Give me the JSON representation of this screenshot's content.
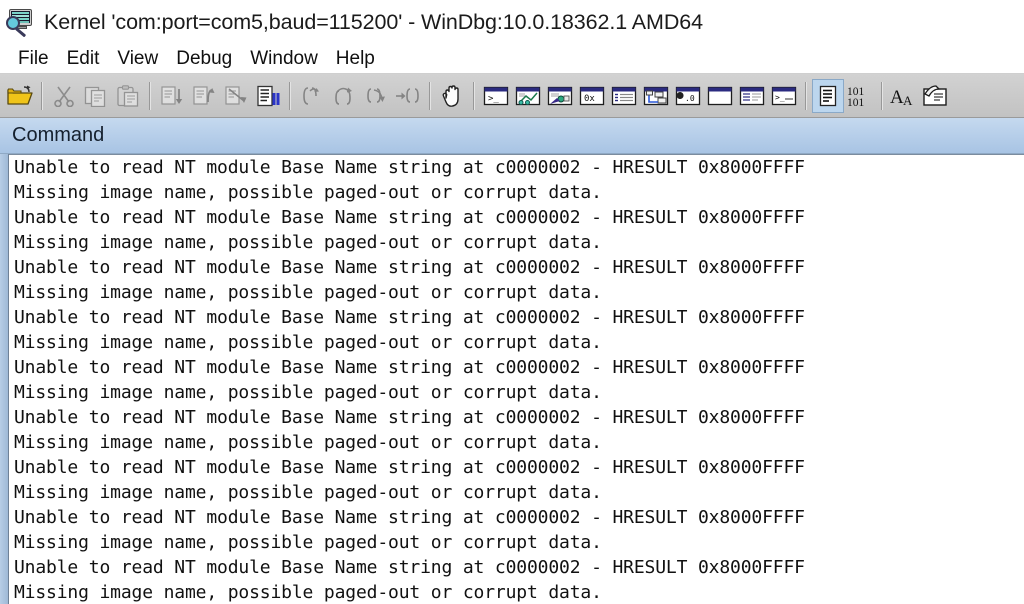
{
  "window": {
    "icon": "windbg-monitor-magnifier-icon",
    "title": "Kernel 'com:port=com5,baud=115200' - WinDbg:10.0.18362.1 AMD64"
  },
  "menubar": {
    "items": [
      {
        "label": "File",
        "name": "menu-file"
      },
      {
        "label": "Edit",
        "name": "menu-edit"
      },
      {
        "label": "View",
        "name": "menu-view"
      },
      {
        "label": "Debug",
        "name": "menu-debug"
      },
      {
        "label": "Window",
        "name": "menu-window"
      },
      {
        "label": "Help",
        "name": "menu-help"
      }
    ]
  },
  "toolbar": {
    "groups": [
      {
        "buttons": [
          {
            "icon": "open-folder-icon",
            "enabled": true,
            "selected": false
          }
        ]
      },
      {
        "buttons": [
          {
            "icon": "cut-scissors-icon",
            "enabled": false,
            "selected": false
          },
          {
            "icon": "copy-icon",
            "enabled": false,
            "selected": false
          },
          {
            "icon": "paste-clipboard-icon",
            "enabled": false,
            "selected": false
          }
        ]
      },
      {
        "buttons": [
          {
            "icon": "step-into-lines-icon",
            "enabled": false,
            "selected": false
          },
          {
            "icon": "step-over-lines-icon",
            "enabled": false,
            "selected": false
          },
          {
            "icon": "step-out-lines-icon",
            "enabled": false,
            "selected": false
          },
          {
            "icon": "break-pause-icon",
            "enabled": true,
            "selected": false
          }
        ]
      },
      {
        "buttons": [
          {
            "icon": "step-into-braces-icon",
            "enabled": false,
            "selected": false
          },
          {
            "icon": "step-over-braces-icon",
            "enabled": false,
            "selected": false
          },
          {
            "icon": "step-out-braces-icon",
            "enabled": false,
            "selected": false
          },
          {
            "icon": "run-to-cursor-braces-icon",
            "enabled": false,
            "selected": false
          }
        ]
      },
      {
        "buttons": [
          {
            "icon": "hand-break-icon",
            "enabled": true,
            "selected": false
          }
        ]
      },
      {
        "buttons": [
          {
            "icon": "command-window-icon",
            "enabled": true,
            "selected": false
          },
          {
            "icon": "watch-window-icon",
            "enabled": true,
            "selected": false
          },
          {
            "icon": "locals-window-icon",
            "enabled": true,
            "selected": false
          },
          {
            "icon": "registers-window-icon",
            "enabled": true,
            "selected": false
          },
          {
            "icon": "memory-window-icon",
            "enabled": true,
            "selected": false
          },
          {
            "icon": "calls-window-icon",
            "enabled": true,
            "selected": false
          },
          {
            "icon": "disassembly-window-icon",
            "enabled": true,
            "selected": false
          },
          {
            "icon": "scratch-pad-window-icon",
            "enabled": true,
            "selected": false
          },
          {
            "icon": "processes-window-icon",
            "enabled": true,
            "selected": false
          },
          {
            "icon": "command-browser-window-icon",
            "enabled": true,
            "selected": false
          }
        ]
      },
      {
        "buttons": [
          {
            "icon": "source-mode-icon",
            "enabled": true,
            "selected": true
          },
          {
            "icon": "assembly-mode-101-icon",
            "enabled": true,
            "selected": false
          }
        ]
      },
      {
        "buttons": [
          {
            "icon": "font-size-icon",
            "enabled": true,
            "selected": false
          },
          {
            "icon": "options-notes-icon",
            "enabled": true,
            "selected": false
          }
        ]
      }
    ]
  },
  "command_pane": {
    "title": "Command",
    "lines": [
      "Unable to read NT module Base Name string at c0000002 - HRESULT 0x8000FFFF",
      "Missing image name, possible paged-out or corrupt data.",
      "Unable to read NT module Base Name string at c0000002 - HRESULT 0x8000FFFF",
      "Missing image name, possible paged-out or corrupt data.",
      "Unable to read NT module Base Name string at c0000002 - HRESULT 0x8000FFFF",
      "Missing image name, possible paged-out or corrupt data.",
      "Unable to read NT module Base Name string at c0000002 - HRESULT 0x8000FFFF",
      "Missing image name, possible paged-out or corrupt data.",
      "Unable to read NT module Base Name string at c0000002 - HRESULT 0x8000FFFF",
      "Missing image name, possible paged-out or corrupt data.",
      "Unable to read NT module Base Name string at c0000002 - HRESULT 0x8000FFFF",
      "Missing image name, possible paged-out or corrupt data.",
      "Unable to read NT module Base Name string at c0000002 - HRESULT 0x8000FFFF",
      "Missing image name, possible paged-out or corrupt data.",
      "Unable to read NT module Base Name string at c0000002 - HRESULT 0x8000FFFF",
      "Missing image name, possible paged-out or corrupt data.",
      "Unable to read NT module Base Name string at c0000002 - HRESULT 0x8000FFFF",
      "Missing image name, possible paged-out or corrupt data."
    ]
  },
  "colors": {
    "titlebar_bg": "#ffffff",
    "toolbar_bg": "#c8c8c8",
    "pane_header_start": "#c5d9ef",
    "pane_header_end": "#a8c4e4",
    "console_bg": "#ffffff",
    "console_text": "#111111",
    "selected_button_bg": "#bcd6ee",
    "window_icon_titlebar": "#2b2b80",
    "folder_yellow": "#f0c419"
  }
}
